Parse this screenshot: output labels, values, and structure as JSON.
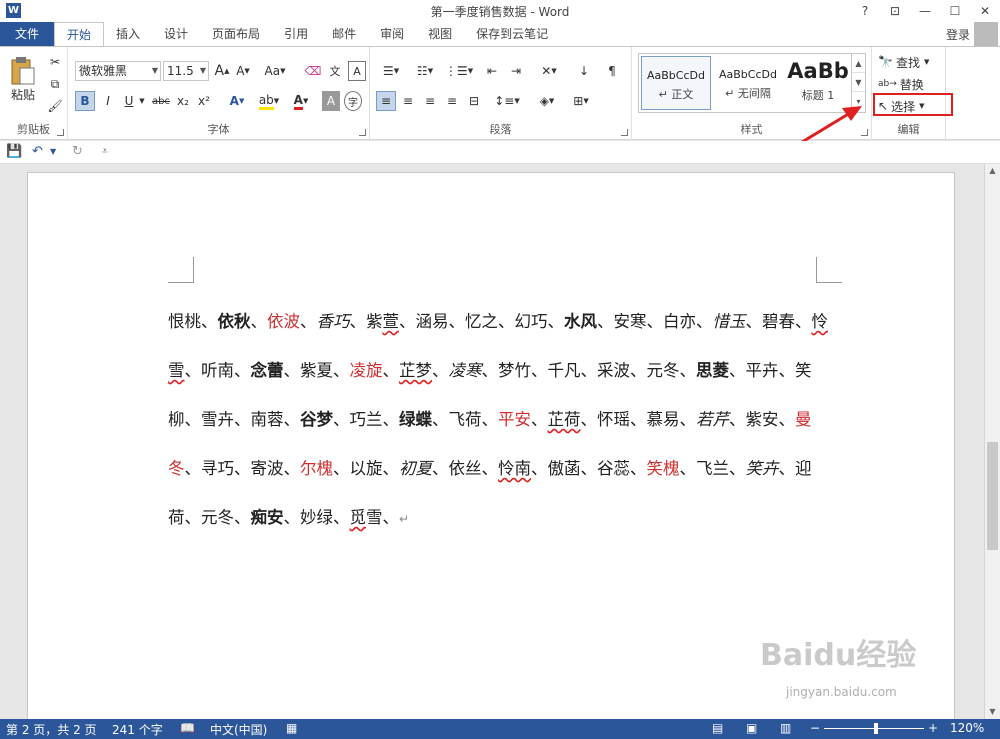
{
  "window": {
    "title": "第一季度销售数据 - Word",
    "app_icon": "W",
    "buttons": [
      "?",
      "⊡",
      "—",
      "☐",
      "✕"
    ]
  },
  "tabs": {
    "file": "文件",
    "items": [
      "开始",
      "插入",
      "设计",
      "页面布局",
      "引用",
      "邮件",
      "审阅",
      "视图",
      "保存到云笔记"
    ],
    "active": "开始",
    "login": "登录"
  },
  "ribbon": {
    "clipboard": {
      "paste": "粘贴",
      "label": "剪贴板"
    },
    "font": {
      "name": "微软雅黑",
      "size": "11.5",
      "grow": "A",
      "shrink": "A",
      "case": "Aa",
      "bold": "B",
      "italic": "I",
      "underline": "U",
      "strike": "abc",
      "sub": "x₂",
      "sup": "x²",
      "label": "字体"
    },
    "paragraph": {
      "label": "段落"
    },
    "styles": {
      "items": [
        {
          "sample": "AaBbCcDd",
          "name": "↵ 正文"
        },
        {
          "sample": "AaBbCcDd",
          "name": "↵ 无间隔"
        },
        {
          "sample": "AaBb",
          "name": "标题 1"
        }
      ],
      "label": "样式"
    },
    "editing": {
      "find": "查找",
      "replace": "替换",
      "select": "选择",
      "label": "编辑"
    }
  },
  "document": {
    "paragraph_mark": "↵",
    "segments": [
      {
        "t": "恨桃、"
      },
      {
        "t": "依秋",
        "s": "b"
      },
      {
        "t": "、"
      },
      {
        "t": "依波",
        "s": "r"
      },
      {
        "t": "、"
      },
      {
        "t": "香巧",
        "s": "i"
      },
      {
        "t": "、紫"
      },
      {
        "t": "萱",
        "s": "w"
      },
      {
        "t": "、涵易、忆之、幻巧、"
      },
      {
        "t": "水风",
        "s": "b"
      },
      {
        "t": "、安寒、白亦、"
      },
      {
        "t": "惜玉",
        "s": "i"
      },
      {
        "t": "、"
      },
      {
        "t": "碧春、"
      },
      {
        "t": "怜雪",
        "s": "w"
      },
      {
        "t": "、听南、"
      },
      {
        "t": "念蕾",
        "s": "b"
      },
      {
        "t": "、紫夏、"
      },
      {
        "t": "凌旋",
        "s": "r"
      },
      {
        "t": "、"
      },
      {
        "t": "芷梦",
        "s": "w"
      },
      {
        "t": "、"
      },
      {
        "t": "凌寒",
        "s": "i"
      },
      {
        "t": "、梦竹、千凡、采波、元冬、"
      },
      {
        "t": "思菱",
        "s": "b"
      },
      {
        "t": "、平卉、笑柳、雪卉、南蓉、"
      },
      {
        "t": "谷梦",
        "s": "b"
      },
      {
        "t": "、巧兰、"
      },
      {
        "t": "绿蝶",
        "s": "b"
      },
      {
        "t": "、飞荷、"
      },
      {
        "t": "平安",
        "s": "r"
      },
      {
        "t": "、"
      },
      {
        "t": "芷荷",
        "s": "w"
      },
      {
        "t": "、怀瑶、"
      },
      {
        "t": "慕易、"
      },
      {
        "t": "若芹",
        "s": "i"
      },
      {
        "t": "、紫安、"
      },
      {
        "t": "曼冬",
        "s": "r"
      },
      {
        "t": "、寻巧、寄波、"
      },
      {
        "t": "尔槐",
        "s": "r"
      },
      {
        "t": "、以旋、"
      },
      {
        "t": "初夏",
        "s": "i"
      },
      {
        "t": "、依丝、"
      },
      {
        "t": "怜南",
        "s": "w"
      },
      {
        "t": "、傲菡、"
      },
      {
        "t": "谷蕊、"
      },
      {
        "t": "笑槐",
        "s": "r"
      },
      {
        "t": "、飞兰、"
      },
      {
        "t": "笑卉",
        "s": "i"
      },
      {
        "t": "、迎荷、元冬、"
      },
      {
        "t": "痴安",
        "s": "b"
      },
      {
        "t": "、妙绿、"
      },
      {
        "t": "觅",
        "s": "w"
      },
      {
        "t": "雪、"
      }
    ]
  },
  "status": {
    "page": "第 2 页，共 2 页",
    "words": "241 个字",
    "lang": "中文(中国)",
    "zoom": "120%",
    "zoom_minus": "−",
    "zoom_plus": "+"
  },
  "watermark": {
    "text": "Baidu经验",
    "sub": "jingyan.baidu.com"
  },
  "colors": {
    "accent": "#2b579a",
    "highlight": "#e02020"
  }
}
